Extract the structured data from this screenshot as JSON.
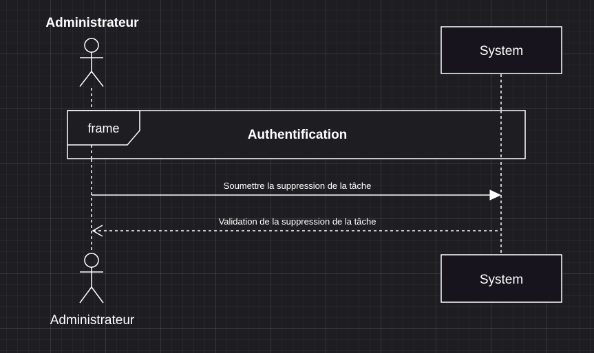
{
  "diagram": {
    "type": "sequence",
    "actor_top_label": "Administrateur",
    "actor_bottom_label": "Administrateur",
    "system_top_label": "System",
    "system_bottom_label": "System",
    "frame_tag": "frame",
    "frame_title": "Authentification",
    "messages": [
      {
        "label": "Soumettre la suppression de la tâche",
        "from": "Administrateur",
        "to": "System",
        "style": "solid"
      },
      {
        "label": "Validation de la suppression de la tâche",
        "from": "System",
        "to": "Administrateur",
        "style": "dashed"
      }
    ],
    "colors": {
      "background": "#1e1d21",
      "stroke": "#ffffff",
      "box_fill": "#18141d"
    }
  }
}
